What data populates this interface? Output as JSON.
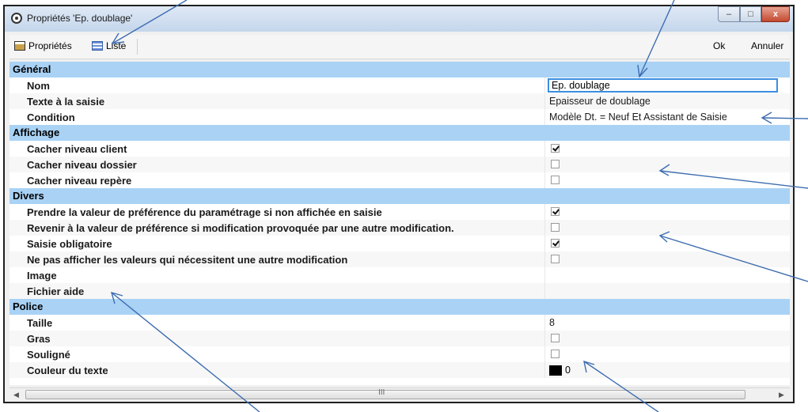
{
  "window": {
    "title": "Propriétés 'Ep. doublage'",
    "controls": {
      "minimize": "–",
      "maximize": "□",
      "close": "x"
    }
  },
  "toolbar": {
    "proprietes_label": "Propriétés",
    "liste_label": "Liste",
    "ok_label": "Ok",
    "annuler_label": "Annuler"
  },
  "grid": {
    "sections": {
      "general": "Général",
      "affichage": "Affichage",
      "divers": "Divers",
      "police": "Police"
    },
    "nom": {
      "label": "Nom",
      "value": "Ep. doublage"
    },
    "texte_saisie": {
      "label": "Texte à la saisie",
      "value": "Epaisseur de doublage"
    },
    "condition": {
      "label": "Condition",
      "value": "Modèle Dt. = Neuf Et Assistant de Saisie"
    },
    "cacher_client": {
      "label": "Cacher niveau client",
      "checked": true
    },
    "cacher_dossier": {
      "label": "Cacher niveau dossier",
      "checked": false
    },
    "cacher_repere": {
      "label": "Cacher niveau repère",
      "checked": false
    },
    "prendre_valeur": {
      "label": "Prendre la valeur de préférence du paramétrage si non affichée en saisie",
      "checked": true
    },
    "revenir_valeur": {
      "label": "Revenir à la valeur de préférence si modification provoquée par une autre modification.",
      "checked": false
    },
    "saisie_obligatoire": {
      "label": "Saisie obligatoire",
      "checked": true
    },
    "ne_pas_afficher": {
      "label": "Ne pas afficher les valeurs qui nécessitent une autre modification",
      "checked": false
    },
    "image": {
      "label": "Image",
      "value": ""
    },
    "fichier_aide": {
      "label": "Fichier aide",
      "value": ""
    },
    "taille": {
      "label": "Taille",
      "value": "8"
    },
    "gras": {
      "label": "Gras",
      "checked": false
    },
    "souligne": {
      "label": "Souligné",
      "checked": false
    },
    "couleur_texte": {
      "label": "Couleur du texte",
      "value": "0",
      "swatch_color": "#000000"
    }
  },
  "scrollbar": {
    "left_arrow": "◀",
    "right_arrow": "▶",
    "grip": "III"
  },
  "colors": {
    "category_band": "#a9d2f5",
    "annotation_arrow": "#3d6db0",
    "focus_border": "#3c8ee0"
  }
}
